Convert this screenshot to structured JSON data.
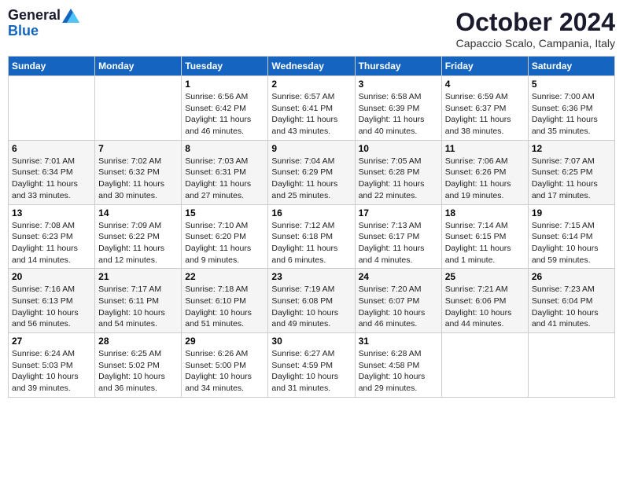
{
  "header": {
    "logo_general": "General",
    "logo_blue": "Blue",
    "month": "October 2024",
    "location": "Capaccio Scalo, Campania, Italy"
  },
  "weekdays": [
    "Sunday",
    "Monday",
    "Tuesday",
    "Wednesday",
    "Thursday",
    "Friday",
    "Saturday"
  ],
  "weeks": [
    [
      {
        "day": "",
        "detail": ""
      },
      {
        "day": "",
        "detail": ""
      },
      {
        "day": "1",
        "detail": "Sunrise: 6:56 AM\nSunset: 6:42 PM\nDaylight: 11 hours and 46 minutes."
      },
      {
        "day": "2",
        "detail": "Sunrise: 6:57 AM\nSunset: 6:41 PM\nDaylight: 11 hours and 43 minutes."
      },
      {
        "day": "3",
        "detail": "Sunrise: 6:58 AM\nSunset: 6:39 PM\nDaylight: 11 hours and 40 minutes."
      },
      {
        "day": "4",
        "detail": "Sunrise: 6:59 AM\nSunset: 6:37 PM\nDaylight: 11 hours and 38 minutes."
      },
      {
        "day": "5",
        "detail": "Sunrise: 7:00 AM\nSunset: 6:36 PM\nDaylight: 11 hours and 35 minutes."
      }
    ],
    [
      {
        "day": "6",
        "detail": "Sunrise: 7:01 AM\nSunset: 6:34 PM\nDaylight: 11 hours and 33 minutes."
      },
      {
        "day": "7",
        "detail": "Sunrise: 7:02 AM\nSunset: 6:32 PM\nDaylight: 11 hours and 30 minutes."
      },
      {
        "day": "8",
        "detail": "Sunrise: 7:03 AM\nSunset: 6:31 PM\nDaylight: 11 hours and 27 minutes."
      },
      {
        "day": "9",
        "detail": "Sunrise: 7:04 AM\nSunset: 6:29 PM\nDaylight: 11 hours and 25 minutes."
      },
      {
        "day": "10",
        "detail": "Sunrise: 7:05 AM\nSunset: 6:28 PM\nDaylight: 11 hours and 22 minutes."
      },
      {
        "day": "11",
        "detail": "Sunrise: 7:06 AM\nSunset: 6:26 PM\nDaylight: 11 hours and 19 minutes."
      },
      {
        "day": "12",
        "detail": "Sunrise: 7:07 AM\nSunset: 6:25 PM\nDaylight: 11 hours and 17 minutes."
      }
    ],
    [
      {
        "day": "13",
        "detail": "Sunrise: 7:08 AM\nSunset: 6:23 PM\nDaylight: 11 hours and 14 minutes."
      },
      {
        "day": "14",
        "detail": "Sunrise: 7:09 AM\nSunset: 6:22 PM\nDaylight: 11 hours and 12 minutes."
      },
      {
        "day": "15",
        "detail": "Sunrise: 7:10 AM\nSunset: 6:20 PM\nDaylight: 11 hours and 9 minutes."
      },
      {
        "day": "16",
        "detail": "Sunrise: 7:12 AM\nSunset: 6:18 PM\nDaylight: 11 hours and 6 minutes."
      },
      {
        "day": "17",
        "detail": "Sunrise: 7:13 AM\nSunset: 6:17 PM\nDaylight: 11 hours and 4 minutes."
      },
      {
        "day": "18",
        "detail": "Sunrise: 7:14 AM\nSunset: 6:15 PM\nDaylight: 11 hours and 1 minute."
      },
      {
        "day": "19",
        "detail": "Sunrise: 7:15 AM\nSunset: 6:14 PM\nDaylight: 10 hours and 59 minutes."
      }
    ],
    [
      {
        "day": "20",
        "detail": "Sunrise: 7:16 AM\nSunset: 6:13 PM\nDaylight: 10 hours and 56 minutes."
      },
      {
        "day": "21",
        "detail": "Sunrise: 7:17 AM\nSunset: 6:11 PM\nDaylight: 10 hours and 54 minutes."
      },
      {
        "day": "22",
        "detail": "Sunrise: 7:18 AM\nSunset: 6:10 PM\nDaylight: 10 hours and 51 minutes."
      },
      {
        "day": "23",
        "detail": "Sunrise: 7:19 AM\nSunset: 6:08 PM\nDaylight: 10 hours and 49 minutes."
      },
      {
        "day": "24",
        "detail": "Sunrise: 7:20 AM\nSunset: 6:07 PM\nDaylight: 10 hours and 46 minutes."
      },
      {
        "day": "25",
        "detail": "Sunrise: 7:21 AM\nSunset: 6:06 PM\nDaylight: 10 hours and 44 minutes."
      },
      {
        "day": "26",
        "detail": "Sunrise: 7:23 AM\nSunset: 6:04 PM\nDaylight: 10 hours and 41 minutes."
      }
    ],
    [
      {
        "day": "27",
        "detail": "Sunrise: 6:24 AM\nSunset: 5:03 PM\nDaylight: 10 hours and 39 minutes."
      },
      {
        "day": "28",
        "detail": "Sunrise: 6:25 AM\nSunset: 5:02 PM\nDaylight: 10 hours and 36 minutes."
      },
      {
        "day": "29",
        "detail": "Sunrise: 6:26 AM\nSunset: 5:00 PM\nDaylight: 10 hours and 34 minutes."
      },
      {
        "day": "30",
        "detail": "Sunrise: 6:27 AM\nSunset: 4:59 PM\nDaylight: 10 hours and 31 minutes."
      },
      {
        "day": "31",
        "detail": "Sunrise: 6:28 AM\nSunset: 4:58 PM\nDaylight: 10 hours and 29 minutes."
      },
      {
        "day": "",
        "detail": ""
      },
      {
        "day": "",
        "detail": ""
      }
    ]
  ]
}
